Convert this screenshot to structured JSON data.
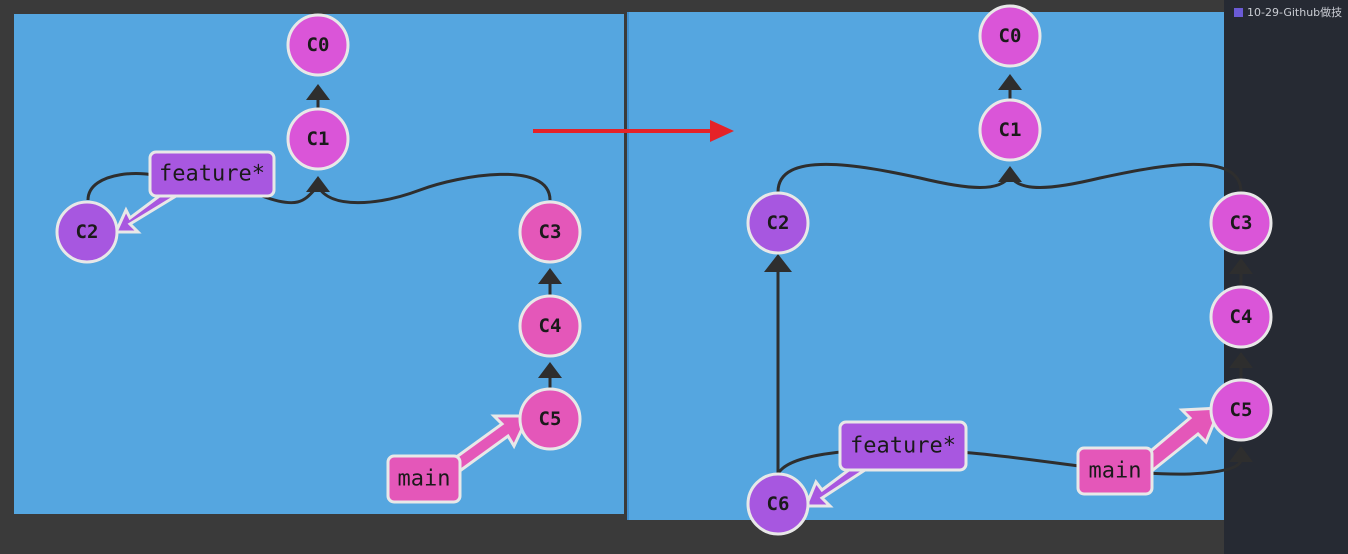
{
  "colors": {
    "panel": "#55a6e0",
    "branch_purple": "#a857e0",
    "branch_pink": "#e457b9",
    "node_magenta": "#da55d8",
    "node_purple": "#a757e0",
    "edge": "#2e2e2e",
    "transition_arrow": "#e52228"
  },
  "before": {
    "nodes": {
      "c0": "C0",
      "c1": "C1",
      "c2": "C2",
      "c3": "C3",
      "c4": "C4",
      "c5": "C5"
    },
    "branches": {
      "feature": "feature*",
      "main": "main"
    }
  },
  "after": {
    "nodes": {
      "c0": "C0",
      "c1": "C1",
      "c2": "C2",
      "c3": "C3",
      "c4": "C4",
      "c5": "C5",
      "c6": "C6"
    },
    "branches": {
      "feature": "feature*",
      "main": "main"
    }
  },
  "transition_arrow": "arrow-right",
  "sidebar": {
    "items": [
      "10-29-Github做技"
    ]
  }
}
